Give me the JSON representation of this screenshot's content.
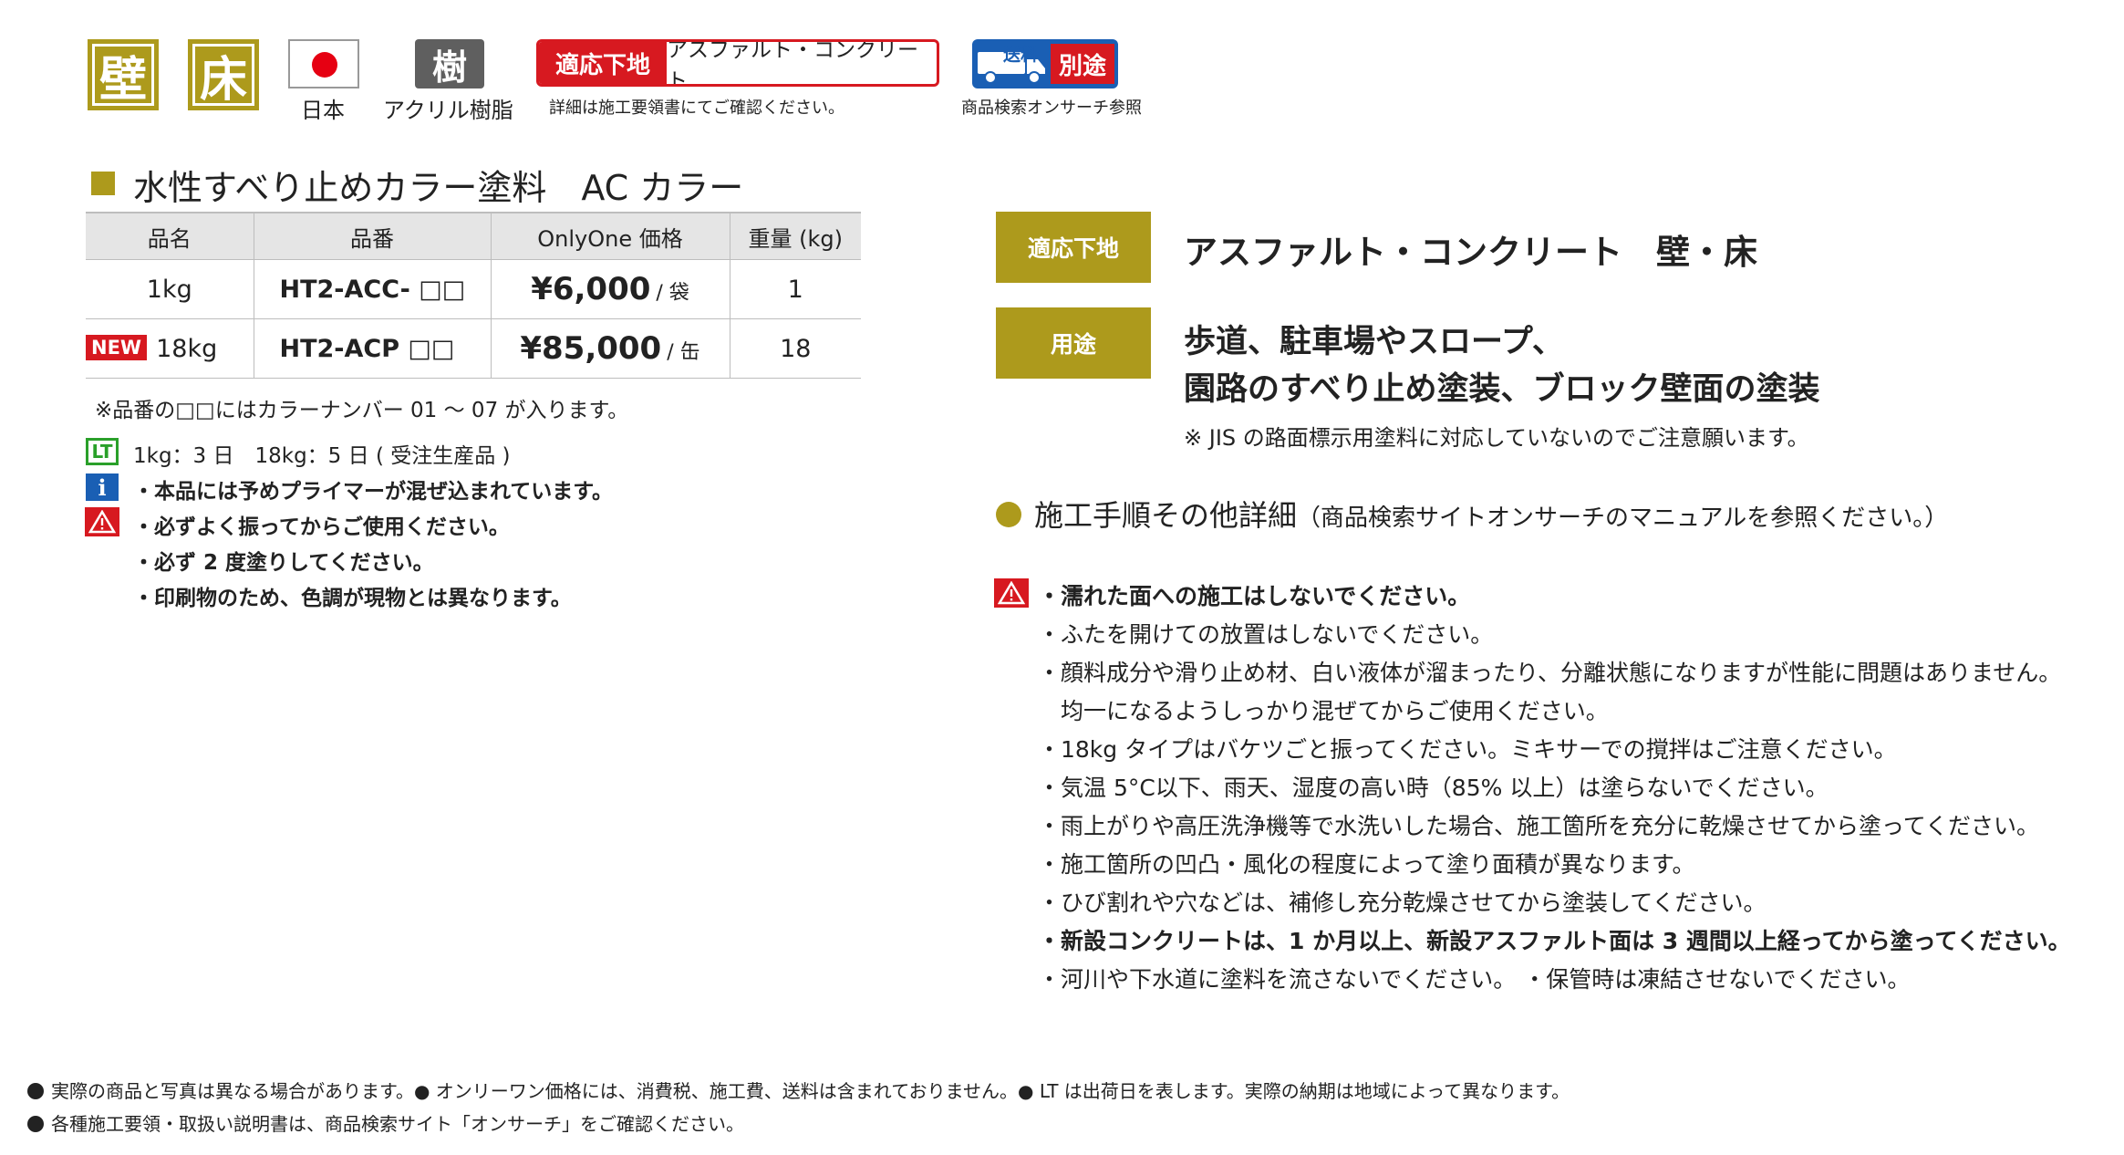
{
  "icons": {
    "wall": "壁",
    "floor": "床",
    "origin_label": "日本",
    "resin_mark": "樹",
    "resin_label": "アクリル樹脂",
    "substrate_label": "適応下地",
    "substrate_value": "アスファルト・コンクリート",
    "substrate_note": "詳細は施工要領書にてご確認ください。",
    "shipping_label": "送料",
    "shipping_value": "別途",
    "shipping_note": "商品検索オンサーチ参照"
  },
  "product": {
    "title": "水性すべり止めカラー塗料　AC カラー",
    "table": {
      "headers": [
        "品名",
        "品番",
        "OnlyOne 価格",
        "重量 (kg)"
      ],
      "rows": [
        {
          "badge": "",
          "name": "1kg",
          "code": "HT2-ACC- □□",
          "price": "¥6,000",
          "unit": "/ 袋",
          "weight": "1"
        },
        {
          "badge": "NEW",
          "name": "18kg",
          "code": "HT2-ACP □□",
          "price": "¥85,000",
          "unit": "/ 缶",
          "weight": "18"
        }
      ]
    },
    "code_note": "※品番の□□にはカラーナンバー 01 ～ 07 が入ります。",
    "lead_time_icon": "LT",
    "lead_time": "1kg：3 日　18kg：5 日 ( 受注生産品 )",
    "info_icon": "i",
    "info": "・本品には予めプライマーが混ぜ込まれています。",
    "warnings": [
      "・必ずよく振ってからご使用ください。",
      "・必ず 2 度塗りしてください。",
      "・印刷物のため、色調が現物とは異なります。"
    ]
  },
  "right": {
    "substrate_label": "適応下地",
    "substrate_value": "アスファルト・コンクリート　壁・床",
    "use_label": "用途",
    "use_line1": "歩道、駐車場やスロープ、",
    "use_line2": "園路のすべり止め塗装、ブロック壁面の塗装",
    "use_note": "※ JIS の路面標示用塗料に対応していないのでご注意願います。",
    "procedure_title": "施工手順その他詳細",
    "procedure_sub": "（商品検索サイトオンサーチのマニュアルを参照ください。）",
    "cautions": [
      "・濡れた面への施工はしないでください。",
      "・ふたを開けての放置はしないでください。",
      "・顔料成分や滑り止め材、白い液体が溜まったり、分離状態になりますが性能に問題はありません。",
      "　均一になるようしっかり混ぜてからご使用ください。",
      "・18kg タイプはバケツごと振ってください。ミキサーでの撹拌はご注意ください。",
      "・気温 5°C以下、雨天、湿度の高い時（85% 以上）は塗らないでください。",
      "・雨上がりや高圧洗浄機等で水洗いした場合、施工箇所を充分に乾燥させてから塗ってください。",
      "・施工箇所の凹凸・風化の程度によって塗り面積が異なります。",
      "・ひび割れや穴などは、補修し充分乾燥させてから塗装してください。",
      "・新設コンクリートは、1 か月以上、新設アスファルト面は 3 週間以上経ってから塗ってください。",
      "・河川や下水道に塗料を流さないでください。 ・保管時は凍結させないでください。"
    ]
  },
  "footer": {
    "line1": "実際の商品と写真は異なる場合があります。● オンリーワン価格には、消費税、施工費、送料は含まれておりません。● LT は出荷日を表します。実際の納期は地域によって異なります。",
    "line2": "各種施工要領・取扱い説明書は、商品検索サイト「オンサーチ」をご確認ください。"
  },
  "colors": {
    "gold": "#ad9a1c",
    "red": "#d71920",
    "blue": "#1a5fb4",
    "green": "#2aa02a"
  }
}
